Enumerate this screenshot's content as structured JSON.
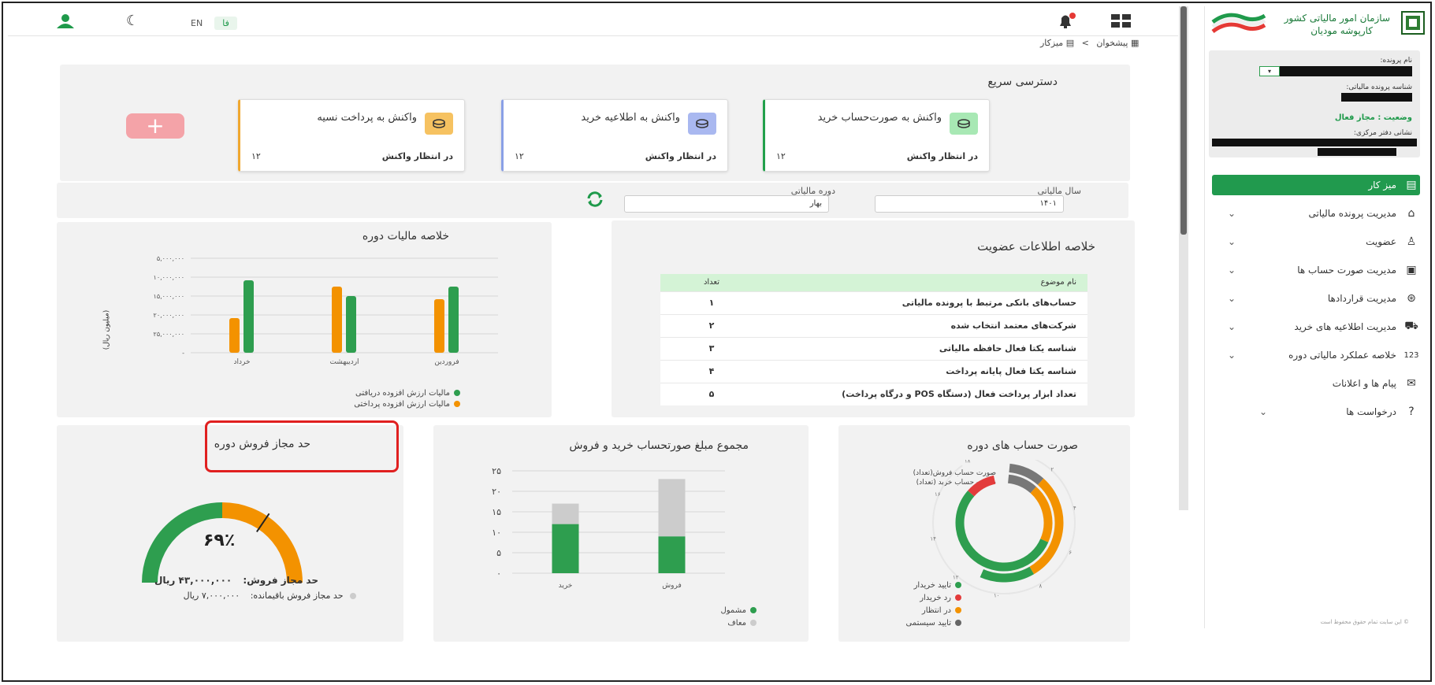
{
  "topbar": {
    "lang_en": "EN",
    "lang_fa": "فا",
    "breadcrumb_home": "پیشخوان",
    "breadcrumb_sep": ">",
    "breadcrumb_current": "میزکار"
  },
  "sidebar": {
    "org_name": "سازمان امور مالیاتی کشور",
    "portal_name": "کارپوشه مودیان",
    "profile": {
      "file_name_label": "نام پرونده:",
      "tax_id_label": "شناسه پرونده مالیاتی:",
      "status_label": "وضعیت : مجاز فعال",
      "address_label": "نشانی دفتر مرکزی:"
    },
    "items": [
      {
        "label": "میز کار",
        "icon": "desk-icon"
      },
      {
        "label": "مدیریت پرونده مالیاتی",
        "icon": "folder-icon"
      },
      {
        "label": "عضویت",
        "icon": "user-icon"
      },
      {
        "label": "مدیریت صورت حساب ها",
        "icon": "invoice-icon"
      },
      {
        "label": "مدیریت قراردادها",
        "icon": "handshake-icon"
      },
      {
        "label": "مدیریت اطلاعیه های خرید",
        "icon": "cart-icon"
      },
      {
        "label": "خلاصه عملکرد مالیاتی دوره",
        "icon": "numbers-icon"
      },
      {
        "label": "پیام ها و اعلانات",
        "icon": "message-icon"
      },
      {
        "label": "درخواست ها",
        "icon": "request-icon"
      }
    ],
    "copyright": "© این سایت تمام حقوق محفوظ است"
  },
  "quick_access": {
    "title": "دسترسی سریع",
    "cards": [
      {
        "title": "واکنش به صورت‌حساب خرید",
        "status": "در انتظار واکنش",
        "count": "۱۲",
        "color": "#22a04b",
        "bg": "#a8e8b4"
      },
      {
        "title": "واکنش به اطلاعیه خرید",
        "status": "در انتظار واکنش",
        "count": "۱۲",
        "color": "#8aa0e6",
        "bg": "#a9b8f0"
      },
      {
        "title": "واکنش به پرداخت نسیه",
        "status": "در انتظار واکنش",
        "count": "۱۲",
        "color": "#f0a830",
        "bg": "#f6c261"
      }
    ]
  },
  "filters": {
    "year_label": "سال مالیاتی",
    "year_value": "۱۴۰۱",
    "period_label": "دوره مالیاتی",
    "period_value": "بهار"
  },
  "membership": {
    "title": "خلاصه اطلاعات عضویت",
    "col_topic": "نام موضوع",
    "col_count": "تعداد",
    "rows": [
      {
        "topic": "حساب‌های بانکی مرتبط با پرونده مالیاتی",
        "count": "۱"
      },
      {
        "topic": "شرکت‌های معتمد انتخاب شده",
        "count": "۲"
      },
      {
        "topic": "شناسه یکتا فعال حافظه مالیاتی",
        "count": "۳"
      },
      {
        "topic": "شناسه یکتا فعال پایانه پرداخت",
        "count": "۴"
      },
      {
        "topic": "تعداد ابزار پرداخت فعال (دستگاه POS و درگاه پرداخت)",
        "count": "۵"
      }
    ]
  },
  "period_tax": {
    "title": "خلاصه مالیات دوره",
    "ylabel": "(میلیون ریال)",
    "legend_received": "مالیات ارزش افزوده دریافتی",
    "legend_paid": "مالیات ارزش افزوده پرداختی"
  },
  "invoices": {
    "title": "صورت حساب های دوره",
    "ring_outer_label": "صورت حساب فروش(تعداد)",
    "ring_inner_label": "صورت حساب خرید (تعداد)",
    "legend": [
      "تایید خریدار",
      "رد خریدار",
      "در انتظار",
      "تایید سیستمی"
    ]
  },
  "sum_invoices": {
    "title": "مجموع مبلغ صورتحساب خرید و فروش",
    "legend_taxable": "مشمول",
    "legend_exempt": "معاف"
  },
  "sales_limit": {
    "title": "حد مجاز فروش دوره",
    "percent": "۶۹٪",
    "percent_value": 69,
    "limit_label": "حد مجاز فروش:",
    "limit_value": "۴۳,۰۰۰,۰۰۰ ریال",
    "remaining_label": "حد مجاز فروش باقیمانده:",
    "remaining_value": "۷,۰۰۰,۰۰۰ ریال"
  },
  "chart_data": [
    {
      "type": "bar",
      "title": "خلاصه مالیات دوره",
      "categories": [
        "فروردین",
        "اردیبهشت",
        "خرداد"
      ],
      "category_labels": [
        "فروردین",
        "اردیبهشت",
        "خرداد"
      ],
      "ylabel": "(میلیون ریال)",
      "y_ticks": [
        "۵,۰۰۰,۰۰۰",
        "۱۰,۰۰۰,۰۰۰",
        "۱۵,۰۰۰,۰۰۰",
        "۲۰,۰۰۰,۰۰۰",
        "۲۵,۰۰۰,۰۰۰",
        "-"
      ],
      "ylim": [
        0,
        30000000
      ],
      "series": [
        {
          "name": "مالیات ارزش افزوده دریافتی",
          "color": "#2e9e4f",
          "values": [
            21000000,
            18000000,
            23000000
          ]
        },
        {
          "name": "مالیات ارزش افزوده پرداختی",
          "color": "#f39200",
          "values": [
            17000000,
            21000000,
            11000000
          ]
        }
      ]
    },
    {
      "type": "bar",
      "stacked": true,
      "title": "مجموع مبلغ صورتحساب خرید و فروش",
      "categories": [
        "فروش",
        "خرید"
      ],
      "category_labels": [
        "فروش",
        "خرید"
      ],
      "y_ticks": [
        "۲۵",
        "۲۰",
        "۱۵",
        "۱۰",
        "۵",
        "۰"
      ],
      "ylim": [
        0,
        25
      ],
      "series": [
        {
          "name": "مشمول",
          "color": "#2e9e4f",
          "values": [
            9,
            12
          ]
        },
        {
          "name": "معاف",
          "color": "#cccccc",
          "values": [
            14,
            5
          ]
        }
      ]
    },
    {
      "type": "pie",
      "title": "صورت حساب های دوره",
      "ring_ticks": [
        "۰",
        "۲",
        "۴",
        "۶",
        "۸",
        "۱۰",
        "۱۲",
        "۱۴",
        "۱۶",
        "۱۸"
      ],
      "max": 20,
      "series": [
        {
          "name": "صورت حساب فروش(تعداد)",
          "segments": [
            {
              "label": "تایید سیستمی",
              "value": 2,
              "color": "#777777"
            },
            {
              "label": "در انتظار",
              "value": 6,
              "color": "#f39200"
            },
            {
              "label": "تایید خریدار",
              "value": 3,
              "color": "#2e9e4f"
            }
          ]
        },
        {
          "name": "صورت حساب خرید (تعداد)",
          "segments": [
            {
              "label": "تایید سیستمی",
              "value": 2,
              "color": "#777777"
            },
            {
              "label": "در انتظار",
              "value": 4,
              "color": "#f39200"
            },
            {
              "label": "تایید خریدار",
              "value": 11,
              "color": "#2e9e4f"
            },
            {
              "label": "رد خریدار",
              "value": 2,
              "color": "#e33b3b"
            }
          ]
        }
      ]
    }
  ]
}
